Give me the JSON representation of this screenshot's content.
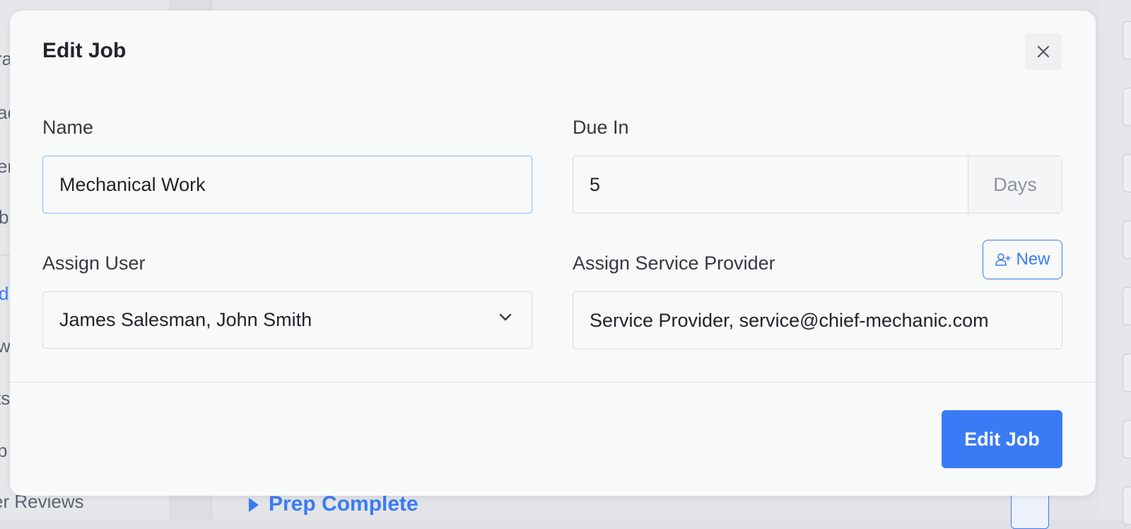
{
  "background": {
    "sidebar_fragments": [
      "ra",
      "ac",
      "er",
      "b",
      "d",
      "w:",
      "ts",
      "p",
      "er Reviews"
    ],
    "section_heading": "Prep Complete"
  },
  "modal": {
    "title": "Edit Job",
    "close_icon": "close-icon",
    "name": {
      "label": "Name",
      "value": "Mechanical Work"
    },
    "due_in": {
      "label": "Due In",
      "value": "5",
      "unit": "Days"
    },
    "assign_user": {
      "label": "Assign User",
      "value": "James Salesman, John Smith"
    },
    "assign_service_provider": {
      "label": "Assign Service Provider",
      "value": "Service Provider, service@chief-mechanic.com",
      "new_button_label": "New",
      "new_button_icon": "user-plus-icon"
    },
    "submit_label": "Edit Job"
  },
  "colors": {
    "accent": "#3a7bf5",
    "modal_bg": "#f8f9f9",
    "border": "#d8dbdf"
  }
}
